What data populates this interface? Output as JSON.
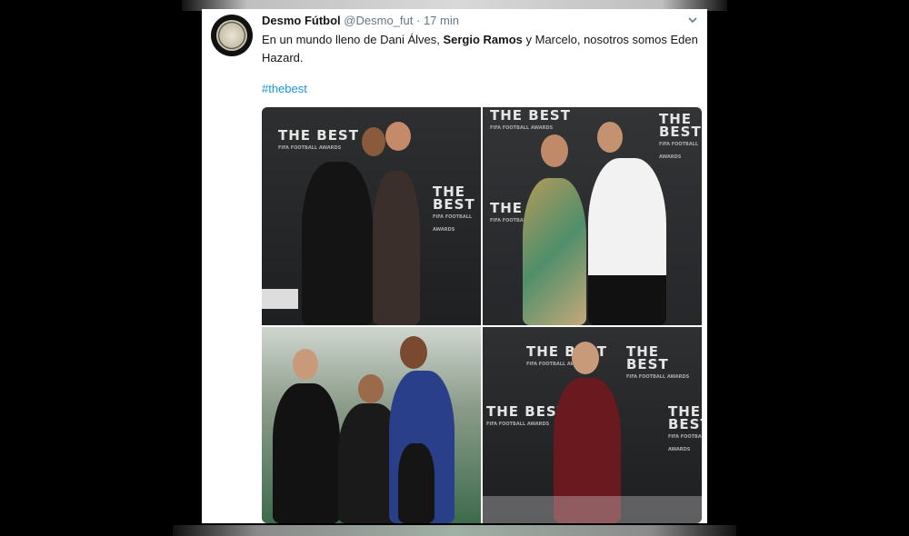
{
  "tweet": {
    "display_name": "Desmo Fútbol",
    "handle": "@Desmo_fut",
    "separator": "·",
    "time": "17 min",
    "text_part1": "En un mundo lleno de Dani Álves, ",
    "text_bold": "Sergio Ramos",
    "text_part2": " y Marcelo, nosotros somos Eden Hazard.",
    "hashtag": "#thebest"
  },
  "icons": {
    "avatar": "desmo-logo",
    "menu": "chevron-down-icon"
  },
  "photos": {
    "logo_text": "THE BEST",
    "logo_sub": "FIFA FOOTBALL AWARDS"
  },
  "colors": {
    "link": "#1b95e0",
    "text": "#14171a",
    "muted": "#657786"
  }
}
